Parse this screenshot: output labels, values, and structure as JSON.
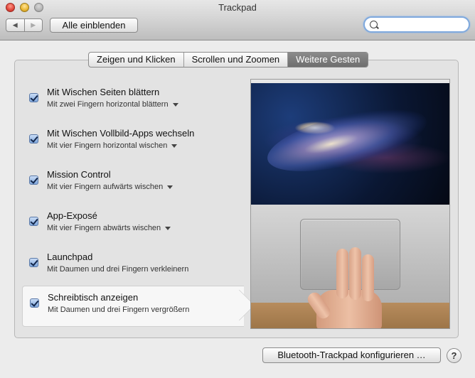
{
  "window": {
    "title": "Trackpad"
  },
  "toolbar": {
    "back_glyph": "◀",
    "forward_glyph": "▶",
    "show_all_label": "Alle einblenden",
    "search_value": "",
    "search_placeholder": ""
  },
  "tabs": [
    {
      "label": "Zeigen und Klicken",
      "active": false
    },
    {
      "label": "Scrollen und Zoomen",
      "active": false
    },
    {
      "label": "Weitere Gesten",
      "active": true
    }
  ],
  "gestures": [
    {
      "title": "Mit Wischen Seiten blättern",
      "subtitle": "Mit zwei Fingern horizontal blättern",
      "checked": true,
      "has_dropdown": true
    },
    {
      "title": "Mit Wischen Vollbild-Apps wechseln",
      "subtitle": "Mit vier Fingern horizontal wischen",
      "checked": true,
      "has_dropdown": true
    },
    {
      "title": "Mission Control",
      "subtitle": "Mit vier Fingern aufwärts wischen",
      "checked": true,
      "has_dropdown": true
    },
    {
      "title": "App-Exposé",
      "subtitle": "Mit vier Fingern abwärts wischen",
      "checked": true,
      "has_dropdown": true
    },
    {
      "title": "Launchpad",
      "subtitle": "Mit Daumen und drei Fingern verkleinern",
      "checked": true,
      "has_dropdown": false
    },
    {
      "title": "Schreibtisch anzeigen",
      "subtitle": "Mit Daumen und drei Fingern vergrößern",
      "checked": true,
      "has_dropdown": false,
      "selected": true
    }
  ],
  "footer": {
    "bluetooth_label": "Bluetooth-Trackpad konfigurieren …",
    "help_label": "?"
  }
}
